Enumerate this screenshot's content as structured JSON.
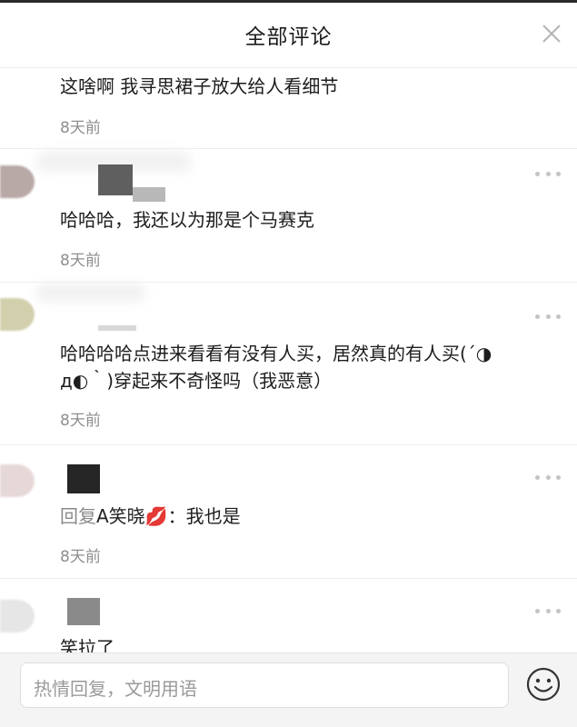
{
  "header": {
    "title": "全部评论",
    "close_icon": "close-icon"
  },
  "comments": [
    {
      "text": "这啥啊 我寻思裙子放大给人看细节",
      "time": "8天前"
    },
    {
      "text": "哈哈哈，我还以为那是个马赛克",
      "time": "8天前"
    },
    {
      "text_line1": "哈哈哈哈点进来看看有没有人买，居然真的有人买(´◑",
      "text_line2": "д◐｀)穿起来不奇怪吗（我恶意）",
      "time": "8天前"
    },
    {
      "reply_prefix": "回复",
      "reply_name": "A笑晓",
      "reply_emoji": "💋",
      "reply_sep": "：",
      "reply_text": "我也是",
      "time": "8天前"
    },
    {
      "text": "笑拉了"
    }
  ],
  "footer": {
    "placeholder": "热情回复，文明用语",
    "emoji_icon": "smiley-face-icon"
  },
  "colors": {
    "time": "#8e8e8e",
    "divider": "#ededed",
    "more_dots": "#c4c4c4"
  }
}
